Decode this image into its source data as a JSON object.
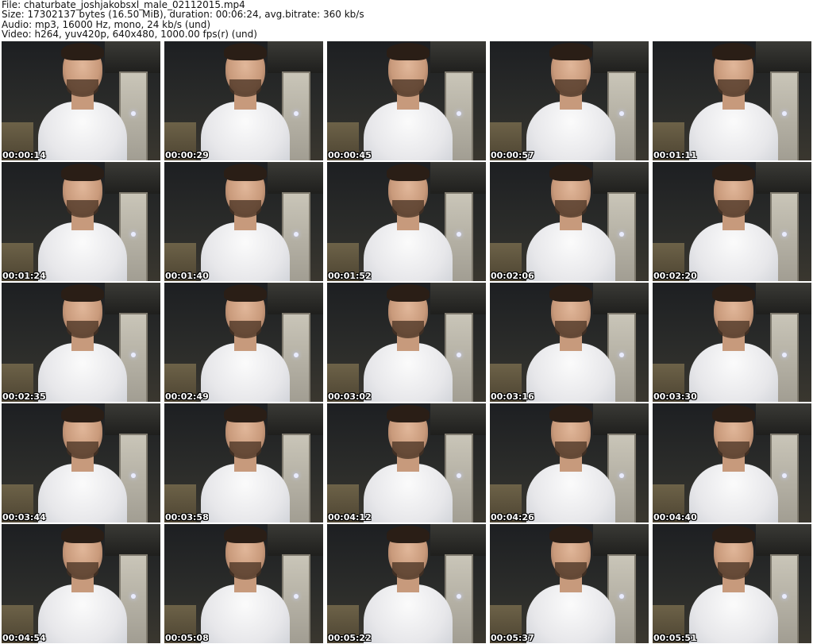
{
  "header": {
    "file_line": "File: chaturbate_joshjakobsxl_male_02112015.mp4",
    "size_line": "Size: 17302137 bytes (16.50 MiB), duration: 00:06:24, avg.bitrate: 360 kb/s",
    "audio_line": "Audio: mp3, 16000 Hz, mono, 24 kb/s (und)",
    "video_line": "Video: h264, yuv420p, 640x480, 1000.00 fps(r) (und)"
  },
  "thumbnails": [
    {
      "timestamp": "00:00:14"
    },
    {
      "timestamp": "00:00:29"
    },
    {
      "timestamp": "00:00:45"
    },
    {
      "timestamp": "00:00:57"
    },
    {
      "timestamp": "00:01:11"
    },
    {
      "timestamp": "00:01:24"
    },
    {
      "timestamp": "00:01:40"
    },
    {
      "timestamp": "00:01:52"
    },
    {
      "timestamp": "00:02:06"
    },
    {
      "timestamp": "00:02:20"
    },
    {
      "timestamp": "00:02:35"
    },
    {
      "timestamp": "00:02:49"
    },
    {
      "timestamp": "00:03:02"
    },
    {
      "timestamp": "00:03:16"
    },
    {
      "timestamp": "00:03:30"
    },
    {
      "timestamp": "00:03:44"
    },
    {
      "timestamp": "00:03:58"
    },
    {
      "timestamp": "00:04:12"
    },
    {
      "timestamp": "00:04:26"
    },
    {
      "timestamp": "00:04:40"
    },
    {
      "timestamp": "00:04:54"
    },
    {
      "timestamp": "00:05:08"
    },
    {
      "timestamp": "00:05:22"
    },
    {
      "timestamp": "00:05:37"
    },
    {
      "timestamp": "00:05:51"
    }
  ]
}
